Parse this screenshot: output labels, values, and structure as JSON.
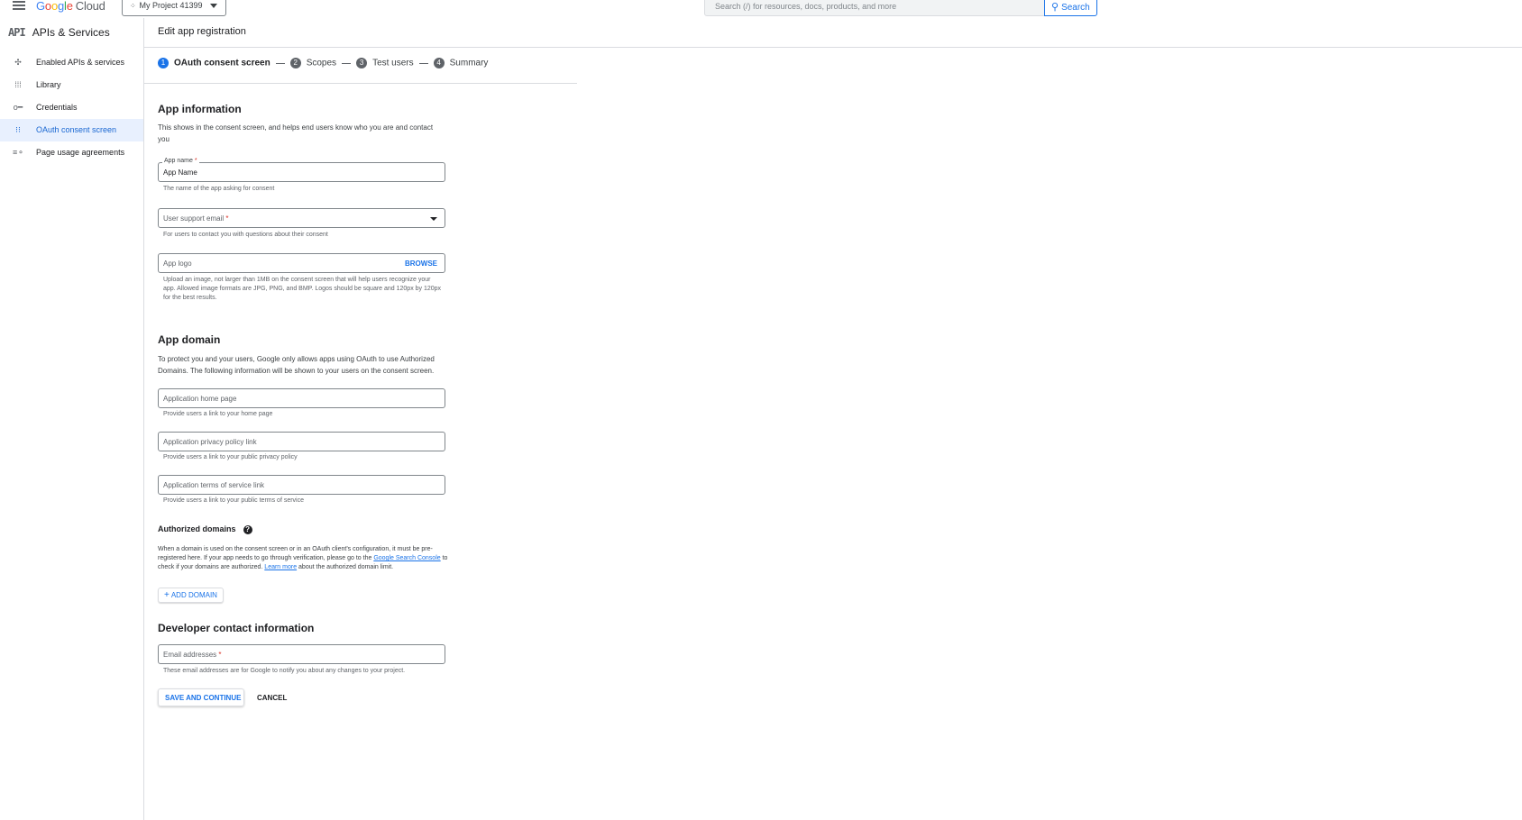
{
  "topbar": {
    "brand_letters": [
      "G",
      "o",
      "o",
      "g",
      "l",
      "e"
    ],
    "brand_product": "Cloud",
    "project_name": "My Project 41399",
    "search_placeholder": "Search (/) for resources, docs, products, and more",
    "search_button": "Search"
  },
  "sidebar": {
    "title": "APIs & Services",
    "api_badge": "API",
    "items": [
      {
        "label": "Enabled APIs & services",
        "icon": "hub-icon",
        "active": false
      },
      {
        "label": "Library",
        "icon": "grid-icon",
        "active": false
      },
      {
        "label": "Credentials",
        "icon": "key-icon",
        "active": false
      },
      {
        "label": "OAuth consent screen",
        "icon": "consent-icon",
        "active": true
      },
      {
        "label": "Page usage agreements",
        "icon": "agreements-icon",
        "active": false
      }
    ]
  },
  "page": {
    "title": "Edit app registration"
  },
  "stepper": {
    "steps": [
      {
        "num": "1",
        "label": "OAuth consent screen",
        "active": true
      },
      {
        "num": "2",
        "label": "Scopes",
        "active": false
      },
      {
        "num": "3",
        "label": "Test users",
        "active": false
      },
      {
        "num": "4",
        "label": "Summary",
        "active": false
      }
    ]
  },
  "app_info": {
    "heading": "App information",
    "description": "This shows in the consent screen, and helps end users know who you are and contact you",
    "app_name_label": "App name",
    "required_mark": "*",
    "app_name_value": "App Name",
    "app_name_hint": "The name of the app asking for consent",
    "support_email_label": "User support email",
    "support_email_hint": "For users to contact you with questions about their consent",
    "logo_label": "App logo",
    "browse_label": "BROWSE",
    "logo_hint": "Upload an image, not larger than 1MB on the consent screen that will help users recognize your app. Allowed image formats are JPG, PNG, and BMP. Logos should be square and 120px by 120px for the best results."
  },
  "app_domain": {
    "heading": "App domain",
    "description": "To protect you and your users, Google only allows apps using OAuth to use Authorized Domains. The following information will be shown to your users on the consent screen.",
    "home_page_placeholder": "Application home page",
    "home_page_hint": "Provide users a link to your home page",
    "privacy_placeholder": "Application privacy policy link",
    "privacy_hint": "Provide users a link to your public privacy policy",
    "tos_placeholder": "Application terms of service link",
    "tos_hint": "Provide users a link to your public terms of service"
  },
  "authorized_domains": {
    "heading": "Authorized domains",
    "help_glyph": "?",
    "desc_part1": "When a domain is used on the consent screen or in an OAuth client's configuration, it must be pre-registered here. If your app needs to go through verification, please go to the ",
    "link_search_console": "Google Search Console",
    "desc_part2": " to check if your domains are authorized. ",
    "link_learn_more": "Learn more",
    "desc_part3": " about the authorized domain limit.",
    "add_domain_plus": "+",
    "add_domain_label": "ADD DOMAIN"
  },
  "developer_contact": {
    "heading": "Developer contact information",
    "email_label": "Email addresses",
    "email_hint": "These email addresses are for Google to notify you about any changes to your project."
  },
  "actions": {
    "save_label": "SAVE AND CONTINUE",
    "cancel_label": "CANCEL"
  },
  "colors": {
    "accent": "#1a73e8",
    "active_bg": "#e8f0fe",
    "required": "#d93025"
  }
}
